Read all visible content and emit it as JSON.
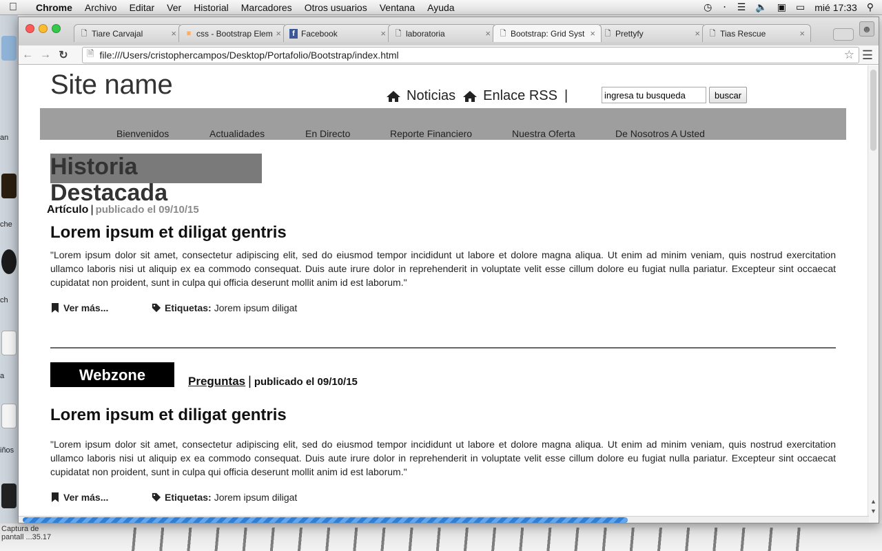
{
  "menubar": {
    "app": "Chrome",
    "items": [
      "Archivo",
      "Editar",
      "Ver",
      "Historial",
      "Marcadores",
      "Otros usuarios",
      "Ventana",
      "Ayuda"
    ],
    "clock": "mié 17:33"
  },
  "desktop": {
    "labels": [
      "an",
      "che",
      "ch",
      "a",
      "iños"
    ],
    "caption_line1": "Captura de",
    "caption_line2": "pantall ...35.17"
  },
  "browser": {
    "tabs": [
      {
        "title": "Tiare Carvajal",
        "favicon": "page-icon",
        "active": false
      },
      {
        "title": "css - Bootstrap Elem",
        "favicon": "stackoverflow-icon",
        "active": false
      },
      {
        "title": "Facebook",
        "favicon": "facebook-icon",
        "active": false
      },
      {
        "title": "laboratoria",
        "favicon": "page-icon",
        "active": false
      },
      {
        "title": "Bootstrap: Grid Syst",
        "favicon": "page-icon",
        "active": true
      },
      {
        "title": "Prettyfy",
        "favicon": "page-icon",
        "active": false
      },
      {
        "title": "Tias Rescue",
        "favicon": "page-icon",
        "active": false
      }
    ],
    "url": "file:///Users/cristophercampos/Desktop/Portafolio/Bootstrap/index.html",
    "load_progress_fraction": 0.72
  },
  "site": {
    "name": "Site name",
    "topnav": [
      "Noticias",
      "Enlace RSS"
    ],
    "topnav_separator": "|",
    "search": {
      "placeholder": "ingresa tu busqueda",
      "button": "buscar"
    },
    "mainnav": [
      "Bienvenidos",
      "Actualidades",
      "En Directo",
      "Reporte Financiero",
      "Nuestra Oferta",
      "De Nosotros A Usted"
    ],
    "featured": {
      "line1": "Historia",
      "line2": "Destacada",
      "type": "Artículo",
      "sep": "|",
      "date": "publicado el 09/10/15"
    },
    "article1": {
      "title": "Lorem ipsum et diligat gentris",
      "body": "\"Lorem ipsum dolor sit amet, consectetur adipiscing elit, sed do eiusmod tempor incididunt ut labore et dolore magna aliqua. Ut enim ad minim veniam, quis nostrud exercitation ullamco laboris nisi ut aliquip ex ea commodo consequat. Duis aute irure dolor in reprehenderit in voluptate velit esse cillum dolore eu fugiat nulla pariatur. Excepteur sint occaecat cupidatat non proident, sunt in culpa qui officia deserunt mollit anim id est laborum.\"",
      "more": "Ver más...",
      "tags_label": "Etiquetas:",
      "tags": "Jorem ipsum diligat"
    },
    "webzone": {
      "label": "Webzone",
      "type": "Preguntas",
      "sep": "|",
      "date": "publicado el 09/10/15"
    },
    "article2": {
      "title": "Lorem ipsum et diligat gentris",
      "body": "\"Lorem ipsum dolor sit amet, consectetur adipiscing elit, sed do eiusmod tempor incididunt ut labore et dolore magna aliqua. Ut enim ad minim veniam, quis nostrud exercitation ullamco laboris nisi ut aliquip ex ea commodo consequat. Duis aute irure dolor in reprehenderit in voluptate velit esse cillum dolore eu fugiat nulla pariatur. Excepteur sint occaecat cupidatat non proident, sunt in culpa qui officia deserunt mollit anim id est laborum.\"",
      "more": "Ver más...",
      "tags_label": "Etiquetas:",
      "tags": "Jorem ipsum diligat"
    }
  },
  "colors": {
    "nav_bg": "#9e9e9e",
    "highlight": "#7a7a7a",
    "webzone_bg": "#000000",
    "progress": "#2f7fd6"
  }
}
